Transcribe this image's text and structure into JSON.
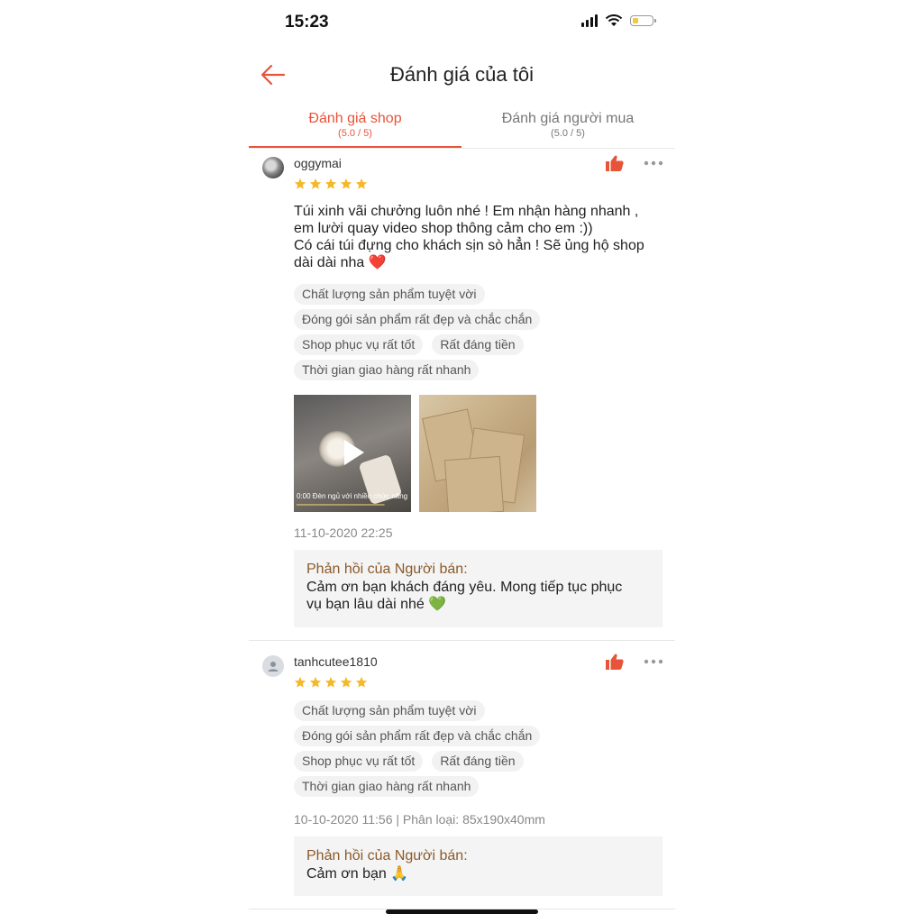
{
  "status_bar": {
    "time": "15:23"
  },
  "header": {
    "title": "Đánh giá của tôi"
  },
  "tabs": [
    {
      "label": "Đánh giá shop",
      "sub": "(5.0 / 5)",
      "active": true
    },
    {
      "label": "Đánh giá người mua",
      "sub": "(5.0 / 5)",
      "active": false
    }
  ],
  "reviews": [
    {
      "username": "oggymai",
      "rating": 5,
      "comment_lines": [
        "Túi xinh vãi chưởng luôn nhé ! Em nhận hàng nhanh ,",
        "em lười quay video shop thông cảm cho em :))",
        "Có cái túi đựng cho khách sịn sò hẳn ! Sẽ ủng hộ shop",
        "dài dài nha ❤️"
      ],
      "tags": {
        "t1": "Chất lượng sản phẩm tuyệt vời",
        "t2": "Đóng gói sản phẩm rất đẹp và chắc chắn",
        "t3": "Shop phục vụ rất tốt",
        "t4": "Rất đáng tiền",
        "t5": "Thời gian giao hàng rất nhanh"
      },
      "video_caption": "0:00 Đèn ngủ với nhiều chức năng",
      "date": "11-10-2020 22:25",
      "reply_heading": "Phản hồi của Người bán:",
      "reply_lines": [
        "Cảm ơn bạn khách đáng yêu. Mong tiếp tục phục",
        "vụ bạn lâu dài nhé 💚"
      ]
    },
    {
      "username": "tanhcutee1810",
      "rating": 5,
      "tags": {
        "t1": "Chất lượng sản phẩm tuyệt vời",
        "t2": "Đóng gói sản phẩm rất đẹp và chắc chắn",
        "t3": "Shop phục vụ rất tốt",
        "t4": "Rất đáng tiền",
        "t5": "Thời gian giao hàng rất nhanh"
      },
      "date": "10-10-2020 11:56 | Phân loại: 85x190x40mm",
      "reply_heading": "Phản hồi của Người bán:",
      "reply_lines": [
        "Cảm ơn bạn 🙏"
      ]
    }
  ],
  "icons": {
    "back": "arrow-left-icon",
    "like": "thumbs-up-icon",
    "more": "more-horizontal-icon",
    "star": "star-icon",
    "play": "play-icon"
  },
  "colors": {
    "accent": "#e8543a",
    "star": "#f5b829",
    "reply_heading": "#8b5a2b",
    "tag_bg": "#f2f2f2",
    "reply_bg": "#f4f4f4"
  }
}
